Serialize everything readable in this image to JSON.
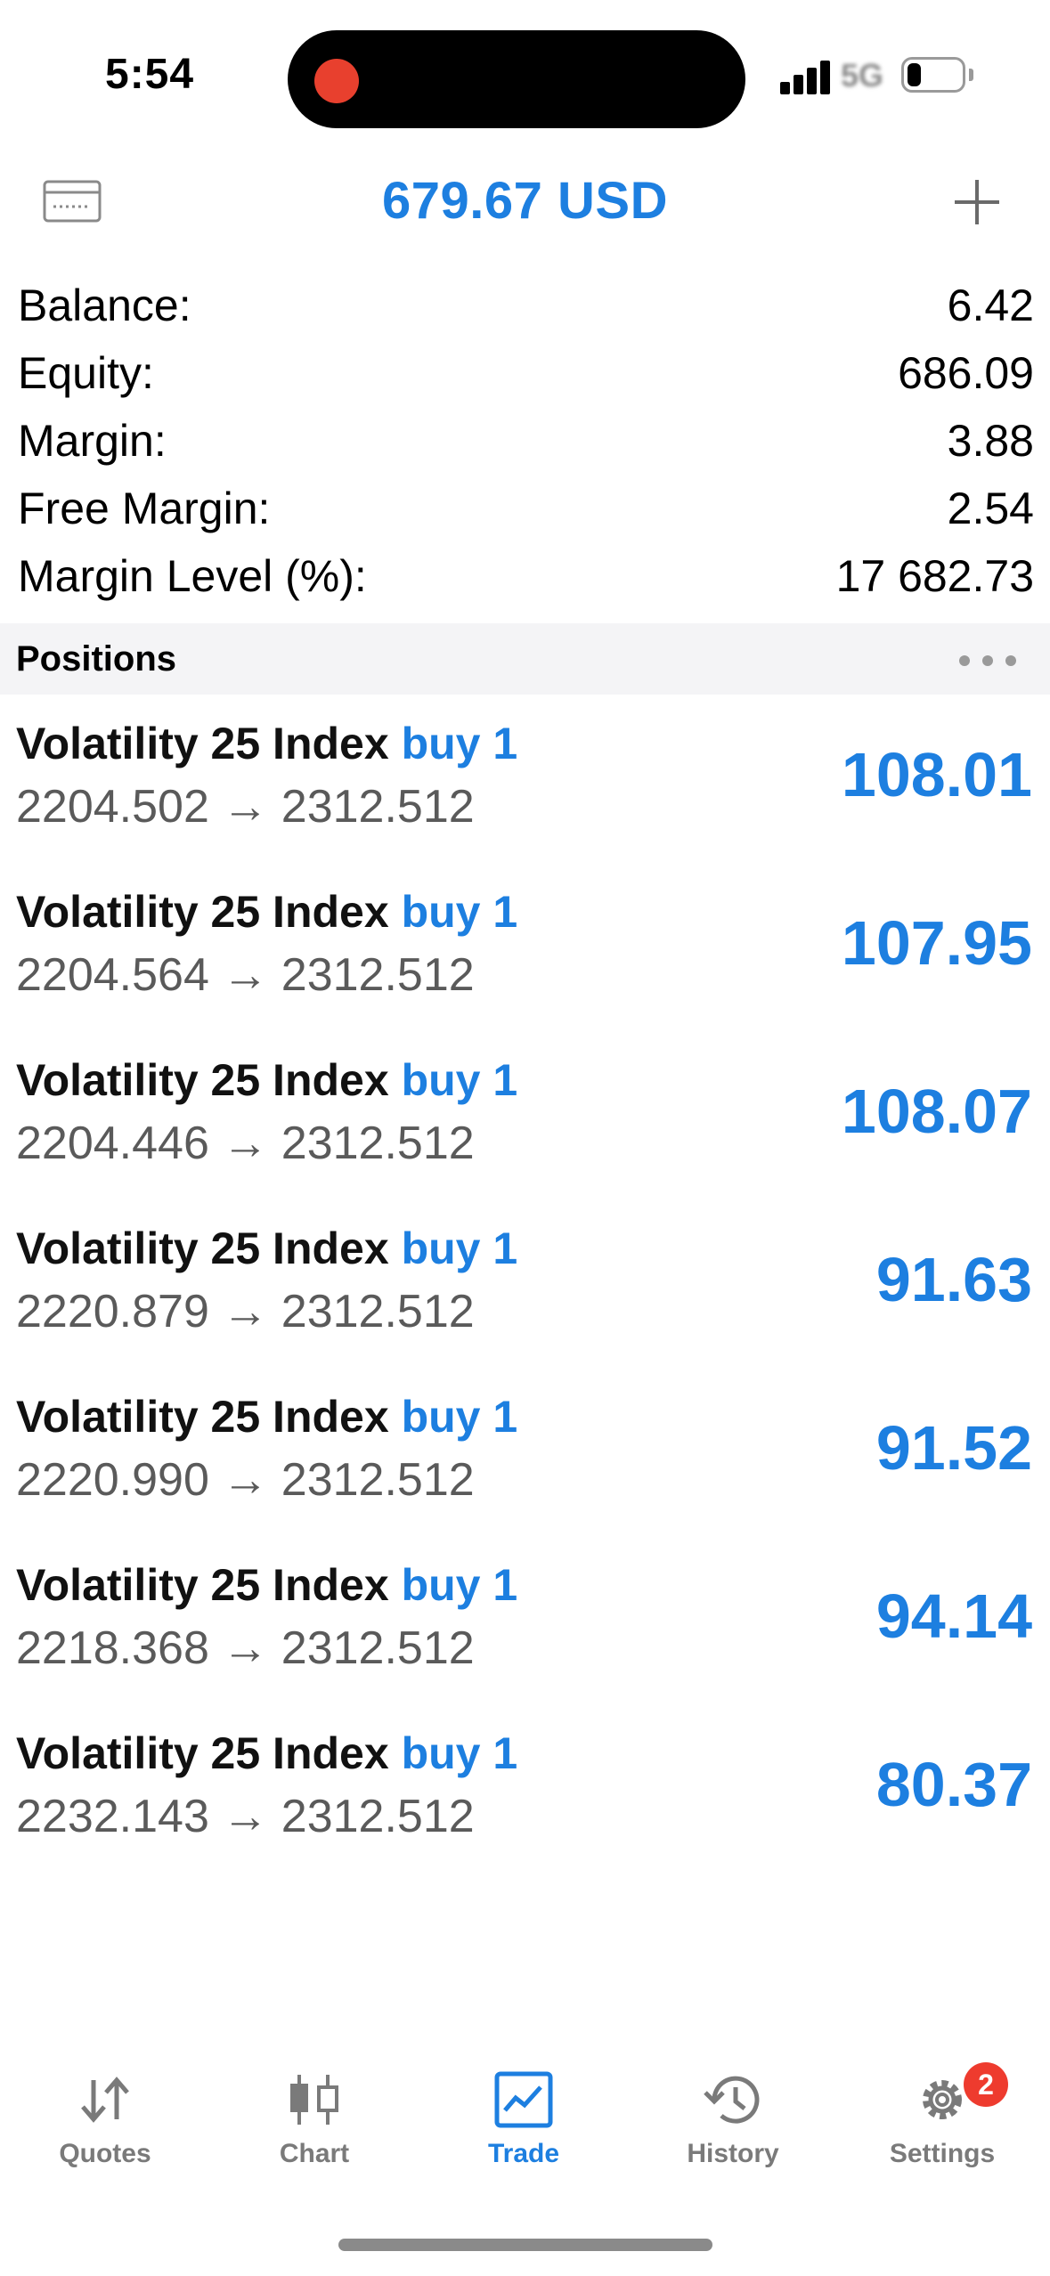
{
  "status_bar": {
    "time": "5:54",
    "network": "5G",
    "battery_level": 0.25
  },
  "header": {
    "title": "679.67 USD"
  },
  "summary": [
    {
      "label": "Balance:",
      "value": "6.42"
    },
    {
      "label": "Equity:",
      "value": "686.09"
    },
    {
      "label": "Margin:",
      "value": "3.88"
    },
    {
      "label": "Free Margin:",
      "value": "2.54"
    },
    {
      "label": "Margin Level (%):",
      "value": "17 682.73"
    }
  ],
  "positions_section": {
    "title": "Positions"
  },
  "positions": [
    {
      "symbol": "Volatility 25 Index",
      "side": "buy 1",
      "prices": "2204.502 → 2312.512",
      "profit": "108.01"
    },
    {
      "symbol": "Volatility 25 Index",
      "side": "buy 1",
      "prices": "2204.564 → 2312.512",
      "profit": "107.95"
    },
    {
      "symbol": "Volatility 25 Index",
      "side": "buy 1",
      "prices": "2204.446 → 2312.512",
      "profit": "108.07"
    },
    {
      "symbol": "Volatility 25 Index",
      "side": "buy 1",
      "prices": "2220.879 → 2312.512",
      "profit": "91.63"
    },
    {
      "symbol": "Volatility 25 Index",
      "side": "buy 1",
      "prices": "2220.990 → 2312.512",
      "profit": "91.52"
    },
    {
      "symbol": "Volatility 25 Index",
      "side": "buy 1",
      "prices": "2218.368 → 2312.512",
      "profit": "94.14"
    },
    {
      "symbol": "Volatility 25 Index",
      "side": "buy 1",
      "prices": "2232.143 → 2312.512",
      "profit": "80.37"
    }
  ],
  "tabs": [
    {
      "label": "Quotes",
      "icon": "quotes-arrows-icon"
    },
    {
      "label": "Chart",
      "icon": "candlestick-chart-icon"
    },
    {
      "label": "Trade",
      "icon": "trade-chart-icon",
      "active": true
    },
    {
      "label": "History",
      "icon": "history-clock-icon"
    },
    {
      "label": "Settings",
      "icon": "gear-icon",
      "badge": "2"
    }
  ],
  "colors": {
    "accent": "#1d7fe0",
    "badge": "#ee3b2e",
    "recording": "#e8402e"
  }
}
